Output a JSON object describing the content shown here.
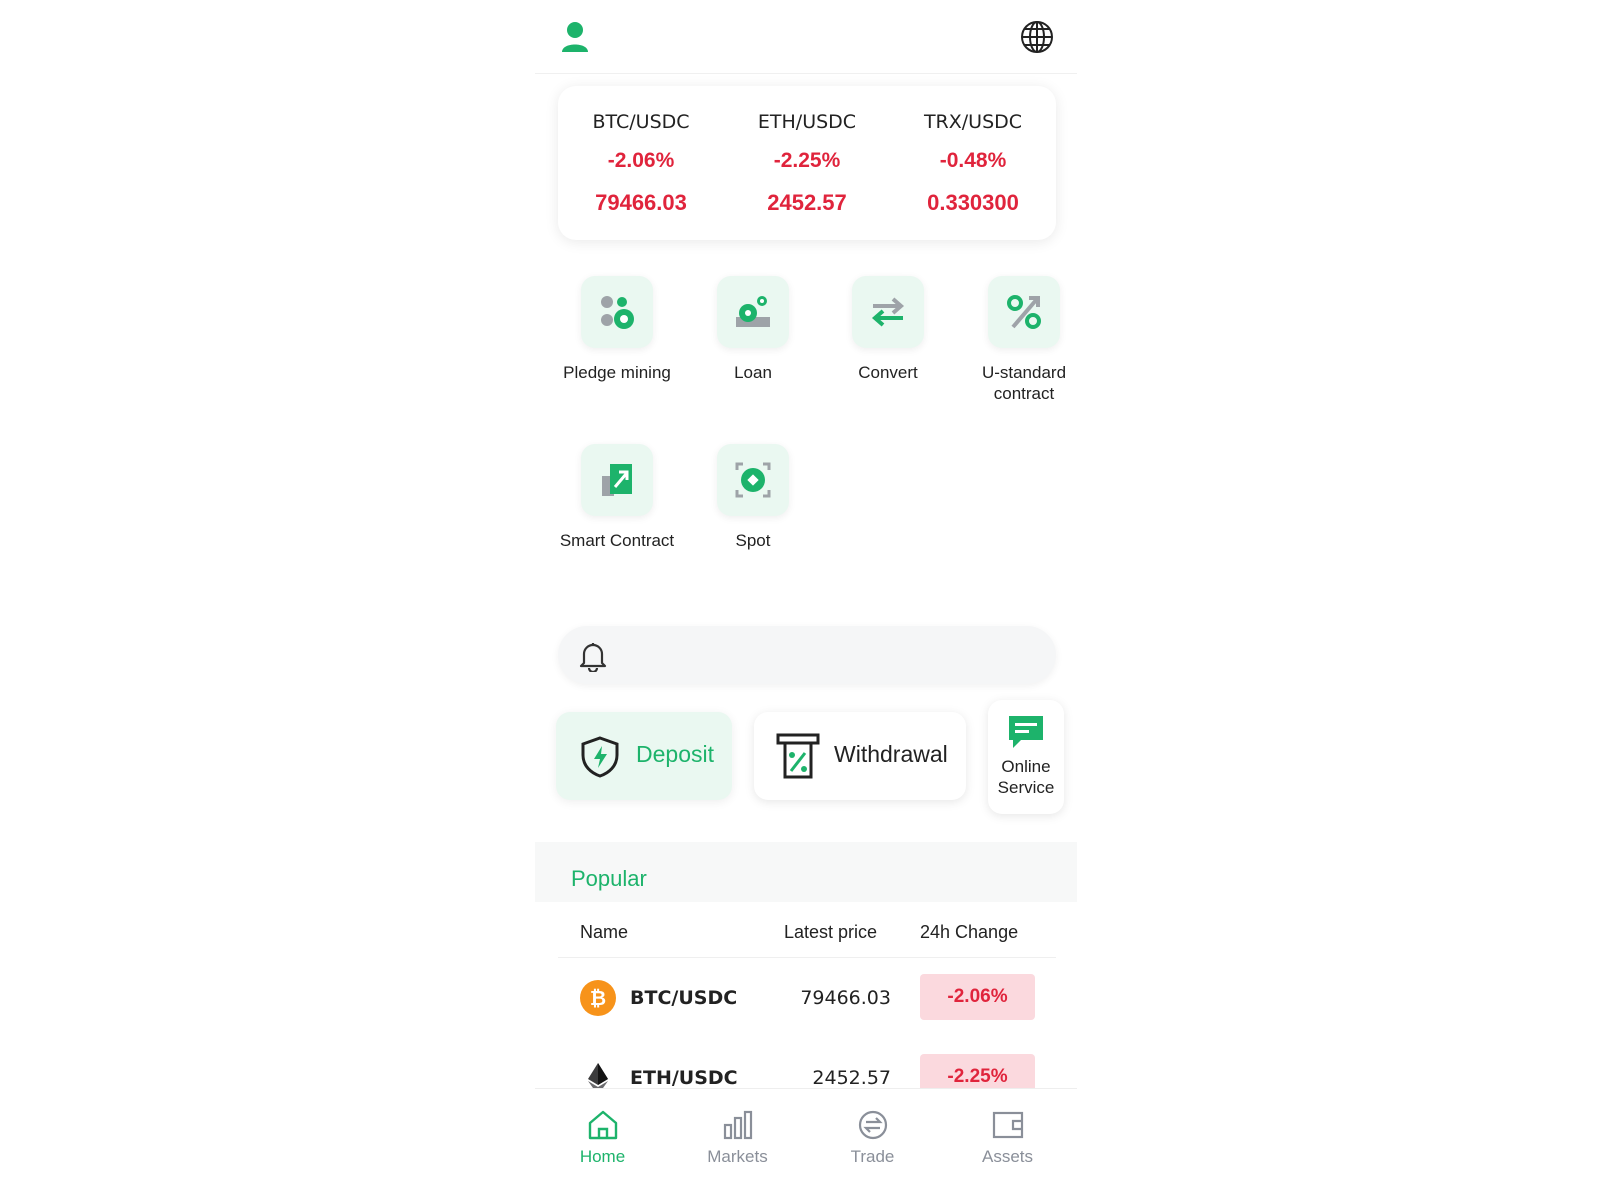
{
  "colors": {
    "accent": "#1db36b",
    "negative": "#e0243c",
    "negative_bg": "#fbd9de"
  },
  "header": {
    "user_icon": "user-icon",
    "language_icon": "globe-icon"
  },
  "tickers": [
    {
      "pair": "BTC/USDC",
      "change": "-2.06%",
      "price": "79466.03"
    },
    {
      "pair": "ETH/USDC",
      "change": "-2.25%",
      "price": "2452.57"
    },
    {
      "pair": "TRX/USDC",
      "change": "-0.48%",
      "price": "0.330300"
    }
  ],
  "features": [
    {
      "label": "Pledge mining",
      "icon": "pledge-mining-icon"
    },
    {
      "label": "Loan",
      "icon": "loan-icon"
    },
    {
      "label": "Convert",
      "icon": "convert-icon"
    },
    {
      "label": "U-standard contract",
      "icon": "percent-icon"
    },
    {
      "label": "Smart Contract",
      "icon": "smart-contract-icon"
    },
    {
      "label": "Spot",
      "icon": "spot-icon"
    }
  ],
  "notice": {
    "icon": "bell-icon"
  },
  "actions": {
    "deposit": "Deposit",
    "withdrawal": "Withdrawal",
    "service": "Online Service"
  },
  "popular": {
    "title": "Popular",
    "columns": [
      "Name",
      "Latest price",
      "24h Change"
    ],
    "rows": [
      {
        "pair": "BTC/USDC",
        "price": "79466.03",
        "change": "-2.06%",
        "icon": "bitcoin-icon"
      },
      {
        "pair": "ETH/USDC",
        "price": "2452.57",
        "change": "-2.25%",
        "icon": "ethereum-icon"
      }
    ]
  },
  "nav": [
    {
      "label": "Home",
      "active": true
    },
    {
      "label": "Markets",
      "active": false
    },
    {
      "label": "Trade",
      "active": false
    },
    {
      "label": "Assets",
      "active": false
    }
  ]
}
